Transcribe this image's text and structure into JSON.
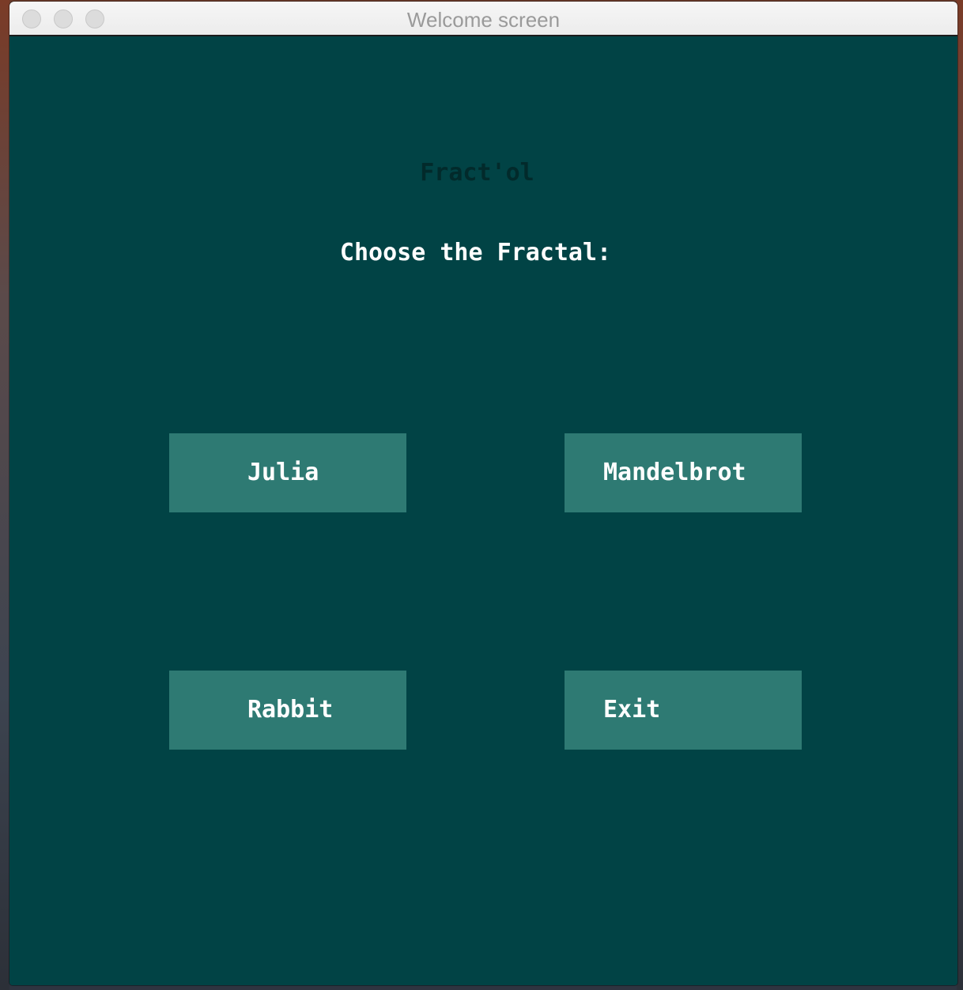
{
  "window": {
    "title": "Welcome screen"
  },
  "app": {
    "title": "Fract'ol",
    "prompt": "Choose the Fractal:"
  },
  "buttons": {
    "julia": "Julia",
    "mandelbrot": "Mandelbrot",
    "rabbit": "Rabbit",
    "exit": "Exit"
  },
  "colors": {
    "background": "#014345",
    "button": "#2e7a73",
    "title_text": "#022a2b",
    "prompt_text": "#ffffff"
  },
  "icons": {
    "close": "close-traffic-light-icon",
    "minimize": "minimize-traffic-light-icon",
    "zoom": "zoom-traffic-light-icon"
  }
}
